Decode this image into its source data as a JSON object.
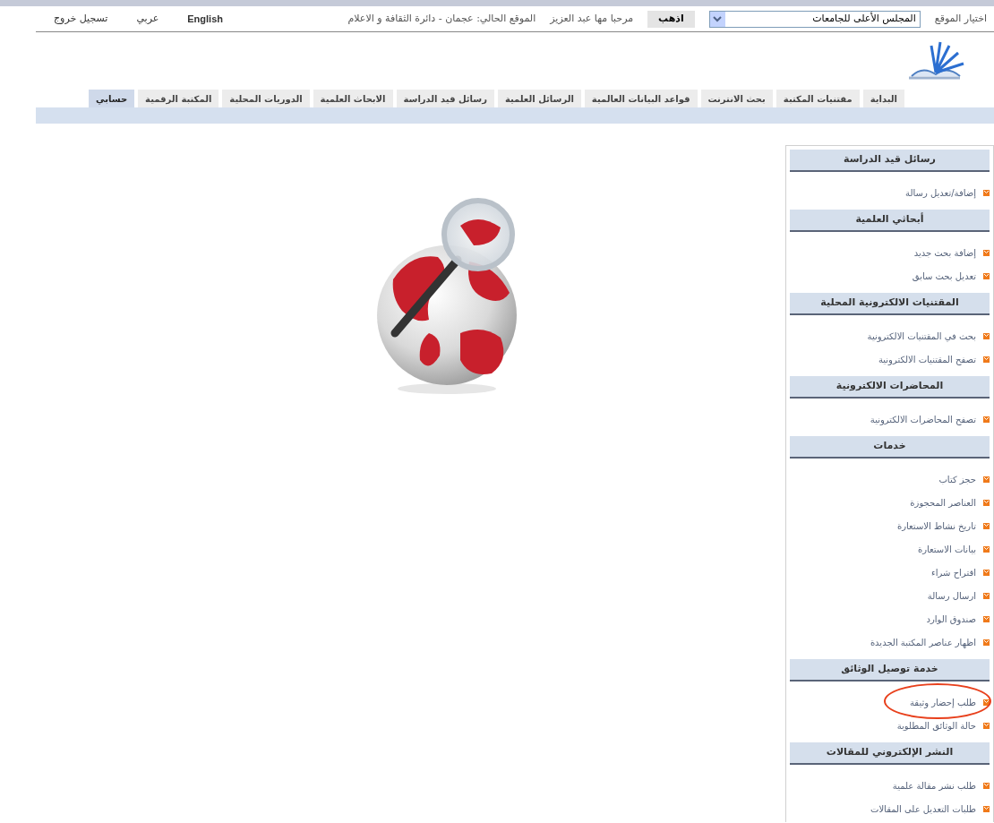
{
  "top_bar": {
    "site_label": "اختيار الموقع",
    "site_select": {
      "value": "المجلس الأعلى للجامعات"
    },
    "go_button": "اذهب",
    "greeting": "مرحبا مها عبد العزيز",
    "current_site": "الموقع الحالي: عجمان - دائرة الثقافة و الاعلام",
    "links": [
      "English",
      "عربي",
      "تسجيل خروج"
    ]
  },
  "nav_tabs": [
    {
      "label": "البداية",
      "selected": false
    },
    {
      "label": "مقتنيات المكتبة",
      "selected": false
    },
    {
      "label": "بحث الانترنت",
      "selected": false
    },
    {
      "label": "قواعد البيانات العالمية",
      "selected": false
    },
    {
      "label": "الرسائل العلمية",
      "selected": false
    },
    {
      "label": "رسائل قيد الدراسة",
      "selected": false
    },
    {
      "label": "الابحاث العلمية",
      "selected": false
    },
    {
      "label": "الدوريات المحلية",
      "selected": false
    },
    {
      "label": "المكتبة الرقمية",
      "selected": false
    },
    {
      "label": "حسابي",
      "selected": true
    }
  ],
  "sidebar": {
    "sections": [
      {
        "title": "رسائل قيد الدراسة",
        "items": [
          {
            "label": "إضافة/تعديل رسالة",
            "circled": false
          }
        ]
      },
      {
        "title": "أبحاثي العلمية",
        "items": [
          {
            "label": "إضافة بحث جديد",
            "circled": false
          },
          {
            "label": "تعديل بحث سابق",
            "circled": false
          }
        ]
      },
      {
        "title": "المقتنيات الالكترونية المحلية",
        "items": [
          {
            "label": "بحث في المقتنيات الالكترونية",
            "circled": false
          },
          {
            "label": "تصفح المقتنيات الالكترونية",
            "circled": false
          }
        ]
      },
      {
        "title": "المحاضرات الالكترونية",
        "items": [
          {
            "label": "تصفح المحاضرات الالكترونية",
            "circled": false
          }
        ]
      },
      {
        "title": "خدمات",
        "items": [
          {
            "label": "حجز كتاب",
            "circled": false
          },
          {
            "label": "العناصر المحجوزة",
            "circled": false
          },
          {
            "label": "تاريخ نشاط الاستعارة",
            "circled": false
          },
          {
            "label": "بيانات الاستعارة",
            "circled": false
          },
          {
            "label": "اقتراح شراء",
            "circled": false
          },
          {
            "label": "ارسال رسالة",
            "circled": false
          },
          {
            "label": "صندوق الوارد",
            "circled": false
          },
          {
            "label": "اظهار عناصر المكتبة الجديدة",
            "circled": false
          }
        ]
      },
      {
        "title": "خدمة توصيل الوثائق",
        "items": [
          {
            "label": "طلب إحضار وثيقة",
            "circled": true
          },
          {
            "label": "حالة الوثائق المطلوبة",
            "circled": false
          }
        ]
      },
      {
        "title": "النشر الإلكتروني للمقالات",
        "items": [
          {
            "label": "طلب نشر مقالة علمية",
            "circled": false
          },
          {
            "label": "طلبات التعديل على المقالات",
            "circled": false
          }
        ]
      }
    ]
  }
}
